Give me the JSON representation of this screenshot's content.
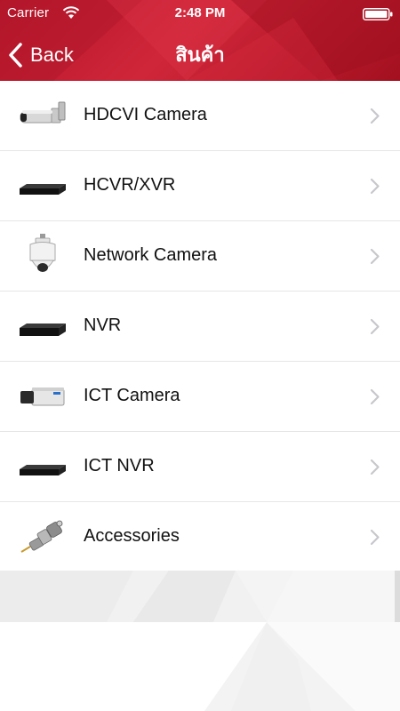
{
  "status_bar": {
    "carrier": "Carrier",
    "time": "2:48 PM",
    "wifi_icon": "wifi-icon",
    "battery_icon": "battery-icon"
  },
  "nav": {
    "back_label": "Back",
    "back_icon": "chevron-left-icon",
    "title": "สินค้า"
  },
  "colors": {
    "header": "#c81e32",
    "header_dark": "#a3101f",
    "row_text": "#111111",
    "chevron": "#c7c7cc",
    "divider": "#e6e6e6"
  },
  "products": [
    {
      "label": "HDCVI Camera",
      "icon": "bullet-camera-icon"
    },
    {
      "label": "HCVR/XVR",
      "icon": "recorder-box-icon"
    },
    {
      "label": "Network Camera",
      "icon": "ptz-dome-camera-icon"
    },
    {
      "label": "NVR",
      "icon": "recorder-box-icon"
    },
    {
      "label": "ICT Camera",
      "icon": "box-camera-icon"
    },
    {
      "label": "ICT NVR",
      "icon": "recorder-box-icon"
    },
    {
      "label": "Accessories",
      "icon": "bnc-connector-icon"
    }
  ]
}
